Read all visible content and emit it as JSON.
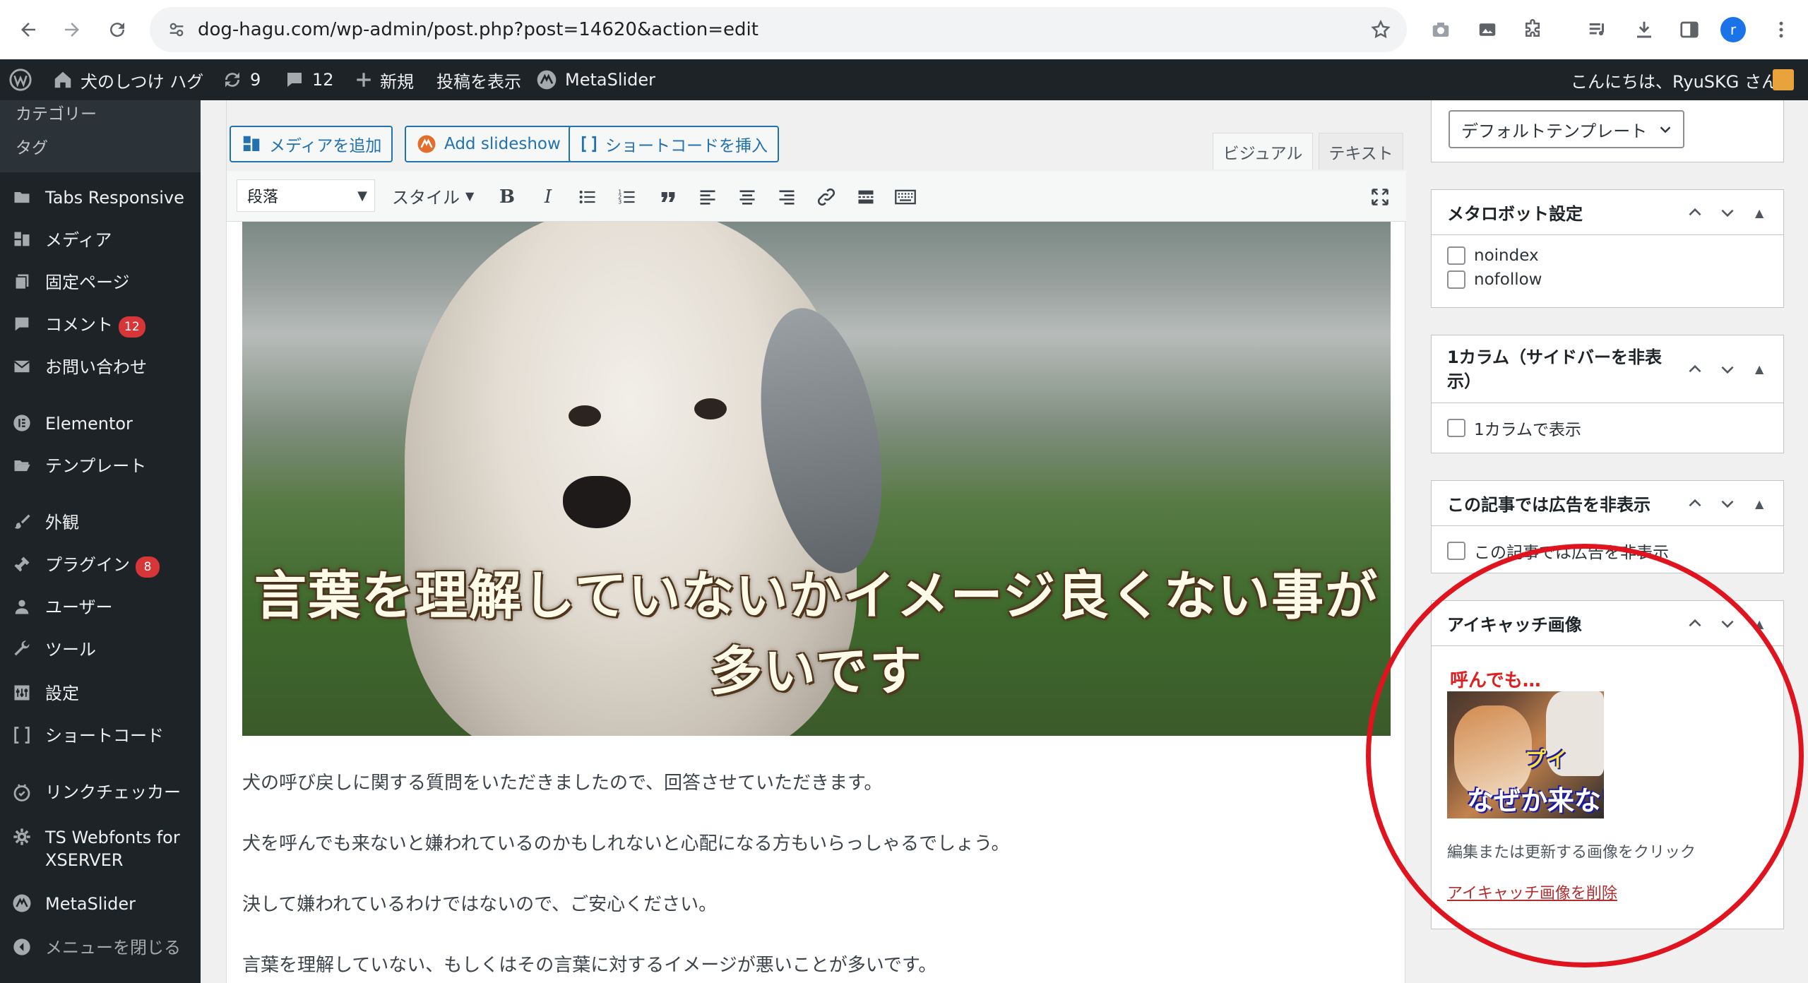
{
  "browser": {
    "url": "dog-hagu.com/wp-admin/post.php?post=14620&action=edit",
    "profile_initial": "r"
  },
  "adminbar": {
    "site_name": "犬のしつけ ハグ",
    "updates_count": "9",
    "comments_count": "12",
    "new_label": "新規",
    "view_post_label": "投稿を表示",
    "metaslider_label": "MetaSlider",
    "greeting": "こんにちは、RyuSKG さん"
  },
  "sidebar": {
    "sub_items": [
      "カテゴリー",
      "タグ"
    ],
    "items": [
      {
        "label": "Tabs Responsive",
        "icon": "folder-icon"
      },
      {
        "label": "メディア",
        "icon": "media-icon"
      },
      {
        "label": "固定ページ",
        "icon": "page-icon"
      },
      {
        "label": "コメント",
        "icon": "comment-icon",
        "badge": "12"
      },
      {
        "label": "お問い合わせ",
        "icon": "mail-icon"
      },
      {
        "label": "Elementor",
        "icon": "elementor-icon"
      },
      {
        "label": "テンプレート",
        "icon": "folder-open-icon"
      },
      {
        "label": "外観",
        "icon": "brush-icon"
      },
      {
        "label": "プラグイン",
        "icon": "plugin-icon",
        "badge": "8"
      },
      {
        "label": "ユーザー",
        "icon": "user-icon"
      },
      {
        "label": "ツール",
        "icon": "wrench-icon"
      },
      {
        "label": "設定",
        "icon": "settings-icon"
      },
      {
        "label": "ショートコード",
        "icon": "brackets-icon"
      },
      {
        "label": "リンクチェッカー",
        "icon": "link-checker-icon"
      },
      {
        "label": "TS Webfonts for",
        "label2": "XSERVER",
        "icon": "gear-icon"
      },
      {
        "label": "MetaSlider",
        "icon": "metaslider-icon"
      },
      {
        "label": "メニューを閉じる",
        "icon": "collapse-icon"
      }
    ]
  },
  "editor": {
    "add_media": "メディアを追加",
    "add_slideshow": "Add slideshow",
    "insert_shortcode": "ショートコードを挿入",
    "tab_visual": "ビジュアル",
    "tab_text": "テキスト",
    "format_select": "段落",
    "style_select": "スタイル",
    "hero_caption": "言葉を理解していないかイメージ良くない事が多いです",
    "paragraphs": [
      "犬の呼び戻しに関する質問をいただきましたので、回答させていただきます。",
      "犬を呼んでも来ないと嫌われているのかもしれないと心配になる方もいらっしゃるでしょう。",
      "決して嫌われているわけではないので、ご安心ください。",
      "言葉を理解していない、もしくはその言葉に対するイメージが悪いことが多いです。"
    ]
  },
  "side": {
    "template_select": "デフォルトテンプレート",
    "meta_robots": {
      "title": "メタロボット設定",
      "options": [
        "noindex",
        "nofollow"
      ]
    },
    "one_column": {
      "title_line1": "1カラム（サイドバーを非表",
      "title_line2": "示）",
      "option": "1カラムで表示"
    },
    "hide_ads": {
      "title": "この記事では広告を非表示",
      "option": "この記事では広告を非表示"
    },
    "featured": {
      "title": "アイキャッチ画像",
      "thumb_text_top": "呼んでも…",
      "thumb_text_mid": "プイ",
      "thumb_text_bottom": "なぜか来ない",
      "hint": "編集または更新する画像をクリック",
      "remove_link": "アイキャッチ画像を削除"
    }
  },
  "colors": {
    "accent": "#2271b1",
    "admin_bg": "#1d2327",
    "badge": "#d63638",
    "highlight_circle": "#e0141e"
  }
}
